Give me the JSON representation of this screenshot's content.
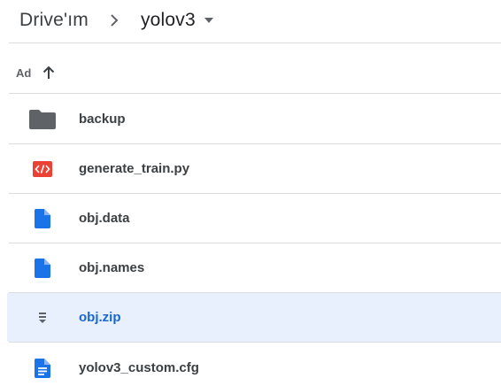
{
  "breadcrumb": {
    "root": "Drive'ım",
    "current": "yolov3"
  },
  "list_header": {
    "name_label": "Ad",
    "sort_icon": "arrow-up-icon"
  },
  "files": [
    {
      "name": "backup",
      "icon": "folder-icon",
      "selected": false
    },
    {
      "name": "generate_train.py",
      "icon": "code-file-icon",
      "selected": false
    },
    {
      "name": "obj.data",
      "icon": "file-icon",
      "selected": false
    },
    {
      "name": "obj.names",
      "icon": "file-icon",
      "selected": false
    },
    {
      "name": "obj.zip",
      "icon": "zip-file-icon",
      "selected": true
    },
    {
      "name": "yolov3_custom.cfg",
      "icon": "document-icon",
      "selected": false
    }
  ],
  "colors": {
    "folder": "#5f6368",
    "code": "#ea4335",
    "file": "#1a73e8",
    "selected_bg": "#e8f0fe",
    "selected_text": "#1967d2"
  }
}
